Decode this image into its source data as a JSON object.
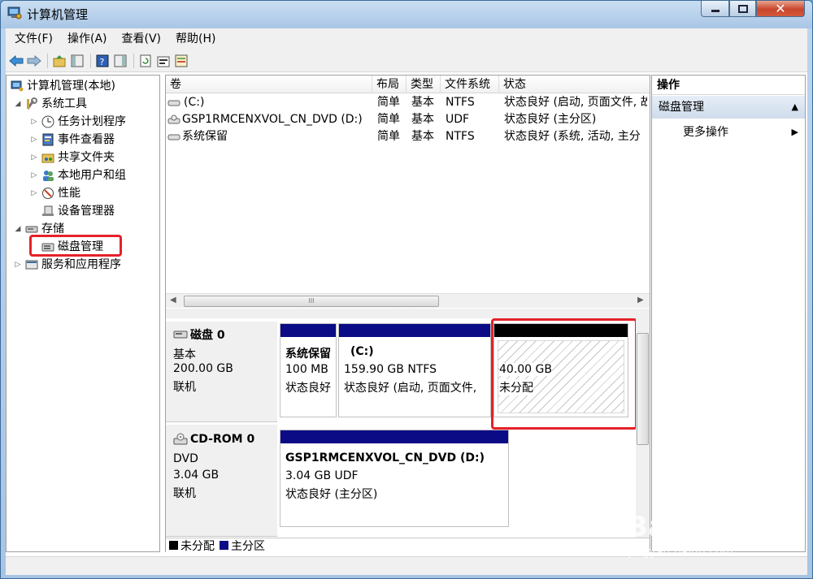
{
  "window": {
    "title": "计算机管理"
  },
  "menu": [
    "文件(F)",
    "操作(A)",
    "查看(V)",
    "帮助(H)"
  ],
  "tree": {
    "root": "计算机管理(本地)",
    "system_tools": "系统工具",
    "task_scheduler": "任务计划程序",
    "event_viewer": "事件查看器",
    "shared_folders": "共享文件夹",
    "local_users": "本地用户和组",
    "performance": "性能",
    "device_manager": "设备管理器",
    "storage": "存储",
    "disk_management": "磁盘管理",
    "services_apps": "服务和应用程序"
  },
  "volume_list": {
    "headers": {
      "volume": "卷",
      "layout": "布局",
      "type": "类型",
      "fs": "文件系统",
      "status": "状态"
    },
    "rows": [
      {
        "volume": "(C:)",
        "layout": "简单",
        "type": "基本",
        "fs": "NTFS",
        "status": "状态良好 (启动, 页面文件, 故"
      },
      {
        "volume": "GSP1RMCENXVOL_CN_DVD (D:)",
        "layout": "简单",
        "type": "基本",
        "fs": "UDF",
        "status": "状态良好 (主分区)"
      },
      {
        "volume": "系统保留",
        "layout": "简单",
        "type": "基本",
        "fs": "NTFS",
        "status": "状态良好 (系统, 活动, 主分"
      }
    ],
    "scroll_thumb_glyph": "III"
  },
  "disks": [
    {
      "name": "磁盘 0",
      "kind": "基本",
      "size": "200.00 GB",
      "state": "联机",
      "partitions": [
        {
          "name": "系统保留",
          "size": "100 MB",
          "status": "状态良好"
        },
        {
          "name": "(C:)",
          "size": "159.90 GB NTFS",
          "status": "状态良好 (启动, 页面文件,"
        },
        {
          "name": "",
          "size": "40.00 GB",
          "status": "未分配"
        }
      ]
    },
    {
      "name": "CD-ROM 0",
      "kind": "DVD",
      "size": "3.04 GB",
      "state": "联机",
      "partitions": [
        {
          "name": "GSP1RMCENXVOL_CN_DVD  (D:)",
          "size": "3.04 GB UDF",
          "status": "状态良好 (主分区)"
        }
      ]
    }
  ],
  "legend": {
    "unallocated": "未分配",
    "primary": "主分区"
  },
  "actions": {
    "header": "操作",
    "section": "磁盘管理",
    "more": "更多操作"
  },
  "colors": {
    "primary_partition": "#0b0b86",
    "unallocated": "#000000",
    "highlight": "#e5212a"
  },
  "watermark": {
    "brand": "Bai",
    "brand_cn": "经验",
    "url": "jingyan.baidu.com"
  }
}
